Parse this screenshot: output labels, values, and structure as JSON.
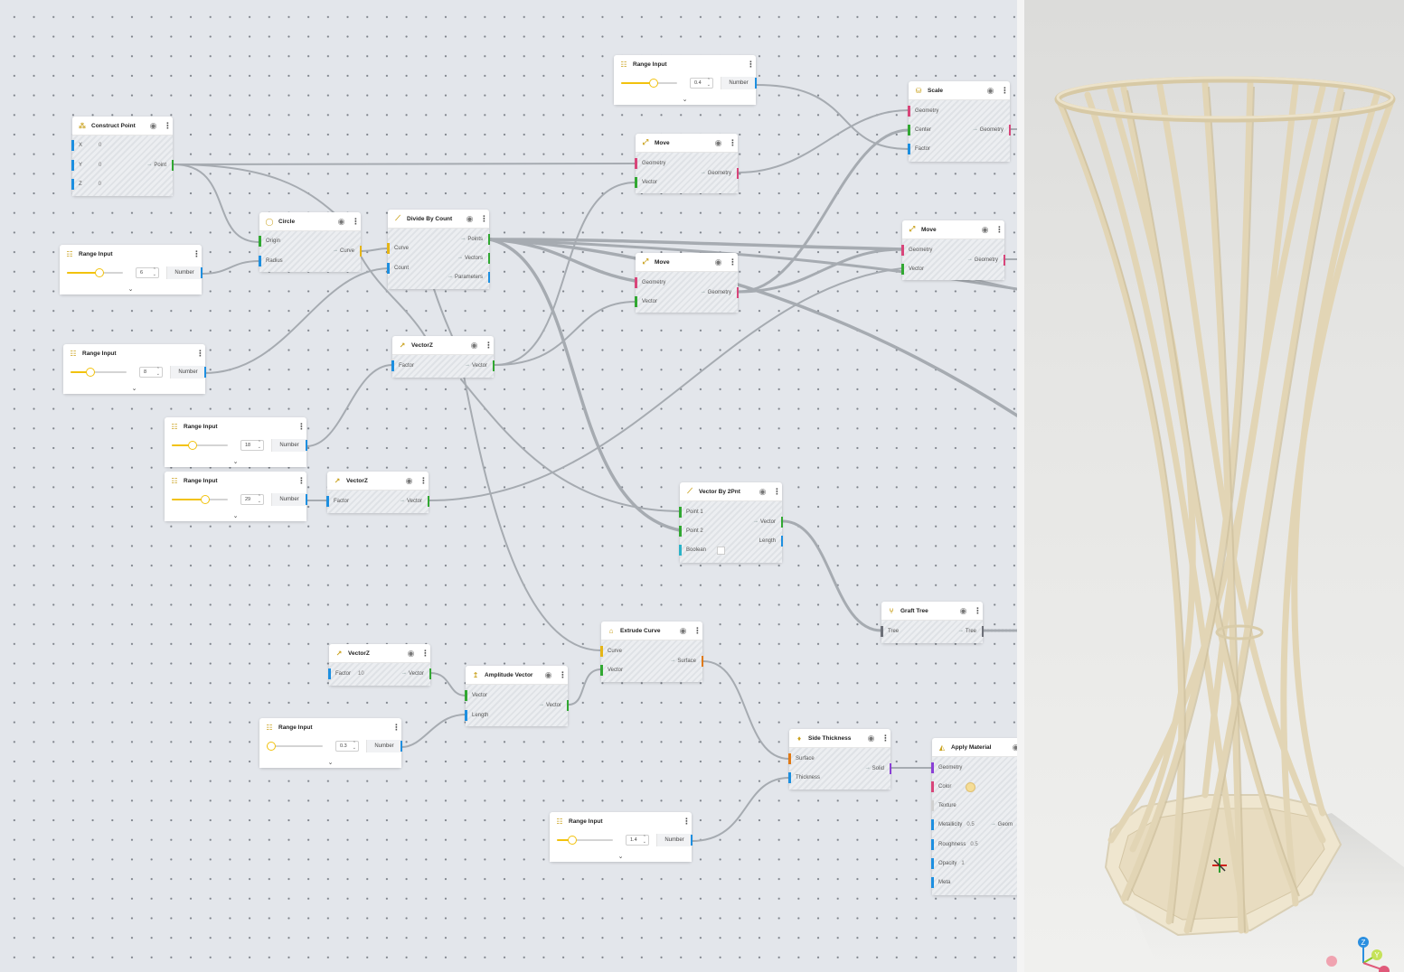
{
  "canvas": {
    "nodes": {
      "construct_point": {
        "title": "Construct Point",
        "inputs": [
          {
            "label": "X",
            "value": "0"
          },
          {
            "label": "Y",
            "value": "0"
          },
          {
            "label": "Z",
            "value": "0"
          }
        ],
        "output": "Point"
      },
      "range_top": {
        "title": "Range Input",
        "value": "0.4",
        "output": "Number",
        "fraction": 0.5
      },
      "range_r1": {
        "title": "Range Input",
        "value": "6",
        "output": "Number",
        "fraction": 0.5
      },
      "range_r2": {
        "title": "Range Input",
        "value": "8",
        "output": "Number",
        "fraction": 0.3
      },
      "range_r3": {
        "title": "Range Input",
        "value": "18",
        "output": "Number",
        "fraction": 0.3
      },
      "range_r4": {
        "title": "Range Input",
        "value": "29",
        "output": "Number",
        "fraction": 0.55
      },
      "range_r5": {
        "title": "Range Input",
        "value": "0.3",
        "output": "Number",
        "fraction": 0.0
      },
      "range_r6": {
        "title": "Range Input",
        "value": "1.4",
        "output": "Number",
        "fraction": 0.2
      },
      "circle": {
        "title": "Circle",
        "inputs": [
          "Origin",
          "Radius"
        ],
        "output": "Curve"
      },
      "divide": {
        "title": "Divide By Count",
        "inputs": [
          "Curve",
          "Count"
        ],
        "outputs": [
          "Points",
          "Vectors",
          "Parameters"
        ]
      },
      "vectorz1": {
        "title": "VectorZ",
        "inputs": [
          "Factor"
        ],
        "output": "Vector"
      },
      "vectorz2": {
        "title": "VectorZ",
        "inputs": [
          "Factor"
        ],
        "output": "Vector"
      },
      "vectorz3": {
        "title": "VectorZ",
        "inputs": [
          "Factor"
        ],
        "factor_value": "10",
        "output": "Vector"
      },
      "move1": {
        "title": "Move",
        "inputs": [
          "Geometry",
          "Vector"
        ],
        "output": "Geometry"
      },
      "move2": {
        "title": "Move",
        "inputs": [
          "Geometry",
          "Vector"
        ],
        "output": "Geometry"
      },
      "move3": {
        "title": "Move",
        "inputs": [
          "Geometry",
          "Vector"
        ],
        "output": "Geometry"
      },
      "scale": {
        "title": "Scale",
        "inputs": [
          "Geometry",
          "Center",
          "Factor"
        ],
        "output": "Geometry"
      },
      "vec2pt": {
        "title": "Vector By 2Pnt",
        "inputs": [
          "Point 1",
          "Point 2",
          "Boolean"
        ],
        "outputs": [
          "Vector",
          "Length"
        ]
      },
      "graft": {
        "title": "Graft Tree",
        "inputs": [
          "Tree"
        ],
        "output": "Tree"
      },
      "extrude": {
        "title": "Extrude Curve",
        "inputs": [
          "Curve",
          "Vector"
        ],
        "output": "Surface"
      },
      "amplitude": {
        "title": "Amplitude Vector",
        "inputs": [
          "Vector",
          "Length"
        ],
        "output": "Vector"
      },
      "side_thickness": {
        "title": "Side Thickness",
        "inputs": [
          "Surface",
          "Thickness"
        ],
        "output": "Solid"
      },
      "apply_material": {
        "title": "Apply Material",
        "inputs": [
          {
            "label": "Geometry",
            "value": ""
          },
          {
            "label": "Color",
            "value": ""
          },
          {
            "label": "Texture",
            "value": ""
          },
          {
            "label": "Metallicity",
            "value": "0.5"
          },
          {
            "label": "Roughness",
            "value": "0.5"
          },
          {
            "label": "Opacity",
            "value": "1"
          },
          {
            "label": "Meta",
            "value": ""
          }
        ],
        "output": "Geom"
      }
    }
  },
  "viewport": {
    "axis_labels": {
      "z": "Z",
      "y": "Y"
    }
  },
  "colors": {
    "accent": "#f2c20d",
    "port_number": "#1d8fe0",
    "port_vector": "#31a832",
    "port_geometry": "#d8457a",
    "port_curve": "#e5b516",
    "port_surface": "#e07a16",
    "port_solid": "#8a3fd6",
    "wire": "#a9aeb4",
    "vase": "#e5dac0"
  }
}
